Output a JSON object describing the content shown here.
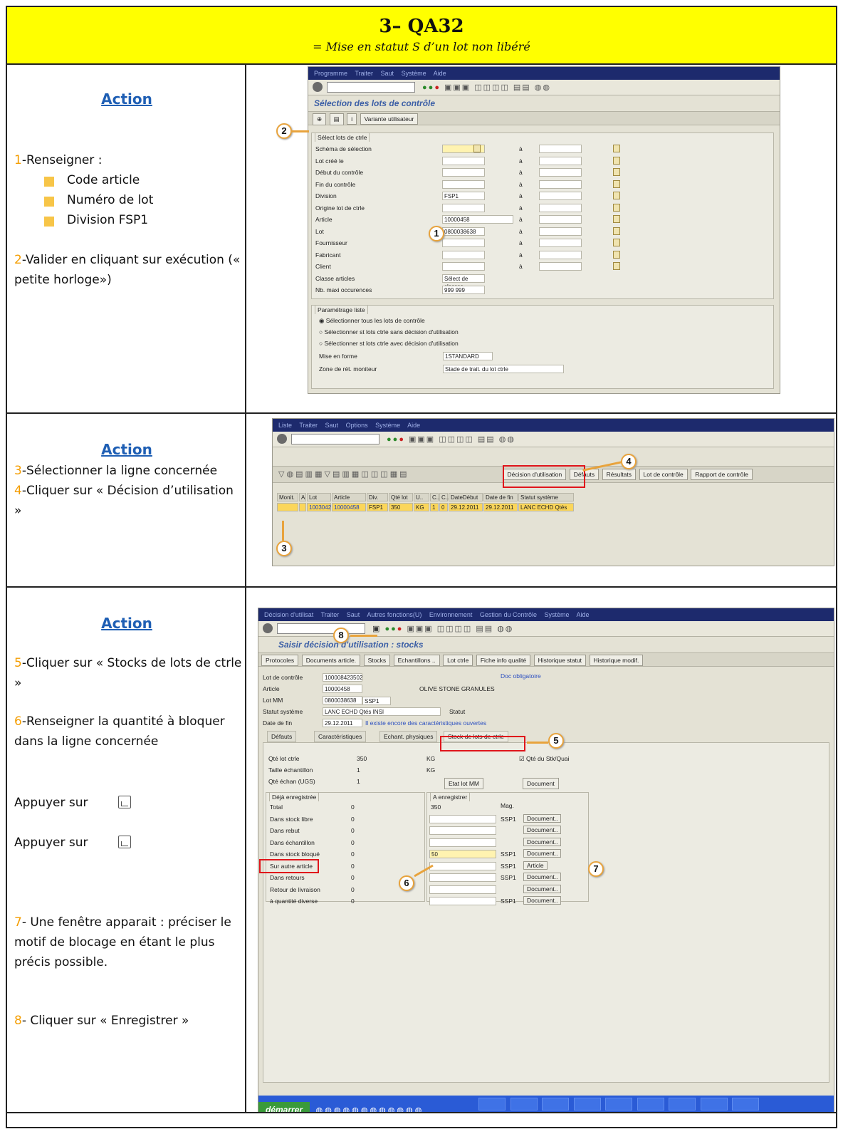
{
  "header": {
    "title": "3– QA32",
    "subtitle": "= Mise en statut S d’un lot non libéré"
  },
  "section1": {
    "action": "Action",
    "step1_num": "1",
    "step1_text": "-Renseigner :",
    "bullets": [
      "Code article",
      "Numéro de lot",
      "Division FSP1"
    ],
    "step2_num": "2",
    "step2_text": "-Valider en cliquant sur exécution (« petite horloge»)",
    "sap": {
      "menu": [
        "Programme",
        "Traiter",
        "Saut",
        "Système",
        "Aide"
      ],
      "title": "Sélection des lots de contrôle",
      "variant_button": "Variante utilisateur",
      "frame1_label": "Sélect lots de ctrle",
      "fields": [
        {
          "label": "Schéma de sélection",
          "value": ""
        },
        {
          "label": "Lot créé le",
          "value": ""
        },
        {
          "label": "Début du contrôle",
          "value": ""
        },
        {
          "label": "Fin du contrôle",
          "value": ""
        },
        {
          "label": "Division",
          "value": "FSP1"
        },
        {
          "label": "Origine lot de ctrle",
          "value": ""
        },
        {
          "label": "Article",
          "value": "10000458"
        },
        {
          "label": "Lot",
          "value": "0800038638"
        },
        {
          "label": "Fournisseur",
          "value": ""
        },
        {
          "label": "Fabricant",
          "value": ""
        },
        {
          "label": "Client",
          "value": ""
        },
        {
          "label": "Classe articles",
          "value": "Sélect de classes"
        },
        {
          "label": "Nb. maxi occurences",
          "value": "999 999"
        }
      ],
      "to_label": "à",
      "frame2_label": "Paramétrage liste",
      "radios": [
        "Sélectionner tous les lots de contrôle",
        "Sélectionner st lots ctrle sans décision d'utilisation",
        "Sélectionner st lots ctrle avec décision d'utilisation"
      ],
      "layout_label": "Mise en forme",
      "layout_value": "1STANDARD",
      "zone_label": "Zone de rét. moniteur",
      "zone_value": "Stade de trait. du lot ctrle"
    },
    "callouts": [
      "2",
      "1"
    ]
  },
  "section2": {
    "action": "Action",
    "step3_num": "3",
    "step3_text": "-Sélectionner la ligne concernée",
    "step4_num": "4",
    "step4_text": "-Cliquer sur « Décision d’utilisation »",
    "sap": {
      "menu": [
        "Liste",
        "Traiter",
        "Saut",
        "Options",
        "Système",
        "Aide"
      ],
      "buttons": [
        "Décision d'utilisation",
        "Défauts",
        "Résultats",
        "Lot de contrôle",
        "Rapport de contrôle"
      ],
      "columns": [
        "Monit.",
        "A",
        "Lot ctrle",
        "Article",
        "Div.",
        "Qté lot",
        "U..",
        "C..",
        "C..",
        "DateDébut",
        "Date de fin",
        "Statut système"
      ],
      "row": [
        "",
        "",
        "1003042",
        "10000458",
        "FSP1",
        "350",
        "KG",
        "1",
        "0",
        "29.12.2011",
        "29.12.2011",
        "LANC ECHD Qtés"
      ]
    },
    "callouts": [
      "4",
      "3"
    ]
  },
  "section3": {
    "action": "Action",
    "step5_num": "5",
    "step5_text": "-Cliquer sur « Stocks de lots de ctrle »",
    "step6_num": "6",
    "step6_text": "-Renseigner la quantité à bloquer dans la ligne concernée",
    "press1": "Appuyer sur",
    "press2": "Appuyer sur",
    "step7_num": "7",
    "step7_text": "- Une fenêtre apparait : préciser le motif de blocage en étant le plus précis possible.",
    "step8_num": "8",
    "step8_text": "- Cliquer sur « Enregistrer »",
    "sap": {
      "menu": [
        "Décision d'utilisat",
        "Traiter",
        "Saut",
        "Autres fonctions(U)",
        "Environnement",
        "Gestion du Contrôle",
        "Système",
        "Aide"
      ],
      "title": "Saisir décision d'utilisation : stocks",
      "app_buttons": [
        "Protocoles",
        "Documents article.",
        "Stocks",
        "Echantillons ..",
        "Lot ctrle",
        "Fiche info qualité",
        "Historique statut",
        "Historique modif."
      ],
      "header_fields": [
        {
          "label": "Lot de contrôle",
          "value": "100008423502"
        },
        {
          "label": "Article",
          "value": "10000458"
        },
        {
          "label": "Lot MM",
          "value": "0800038638"
        },
        {
          "label": "Statut système",
          "value": "LANC ECHD Qtés INSI"
        },
        {
          "label": "Date de fin",
          "value": "29.12.2011"
        }
      ],
      "doc_obligatoire": "Doc obligatoire",
      "article_desc": "OLIVE STONE GRANULES",
      "lotmm_div": "SSP1",
      "statut_util": "Statut",
      "date_note": "Il existe encore des caractéristiques ouvertes",
      "tabs": [
        "Défauts",
        "Caractéristiques",
        "Echant. physiques",
        "Stock de lots de ctrle"
      ],
      "qty_fields": [
        {
          "label": "Qté lot ctrle",
          "value": "350",
          "unit": "KG"
        },
        {
          "label": "Taille échantillon",
          "value": "1",
          "unit": "KG"
        },
        {
          "label": "Qté échan (UGS)",
          "value": "1",
          "unit": ""
        }
      ],
      "checkbox_label": "Qté du Stk/Quai",
      "btn_etat": "Etat lot MM",
      "btn_document": "Document",
      "frame_done": "Déjà enregistrée",
      "frame_todo": "A enregistrer",
      "mag_header": "Mag.",
      "stock_rows": [
        {
          "label": "Total",
          "done": "0",
          "todo": "350",
          "mag": "",
          "btn": ""
        },
        {
          "label": "Dans stock libre",
          "done": "0",
          "todo": "",
          "mag": "SSP1",
          "btn": "Document.."
        },
        {
          "label": "Dans rebut",
          "done": "0",
          "todo": "",
          "mag": "",
          "btn": "Document.."
        },
        {
          "label": "Dans échantillon",
          "done": "0",
          "todo": "",
          "mag": "",
          "btn": "Document.."
        },
        {
          "label": "Dans stock bloqué",
          "done": "0",
          "todo": "50",
          "mag": "SSP1",
          "btn": "Document.."
        },
        {
          "label": "Sur autre article",
          "done": "0",
          "todo": "",
          "mag": "SSP1",
          "btn": "Article"
        },
        {
          "label": "Dans retours",
          "done": "0",
          "todo": "",
          "mag": "SSP1",
          "btn": "Document.."
        },
        {
          "label": "Retour de livraison",
          "done": "0",
          "todo": "",
          "mag": "",
          "btn": "Document.."
        },
        {
          "label": "à quantité diverse",
          "done": "0",
          "todo": "",
          "mag": "SSP1",
          "btn": "Document.."
        }
      ],
      "taskbar_start": "démarrer"
    },
    "callouts": [
      "8",
      "5",
      "7",
      "6"
    ]
  },
  "colors": {
    "header_bg": "#ffff00",
    "action": "#1f5fb4",
    "step_number": "#f49d00",
    "bullet": "#f7c548",
    "highlight_red": "#e0151b",
    "callout_border": "#e8a33c"
  }
}
